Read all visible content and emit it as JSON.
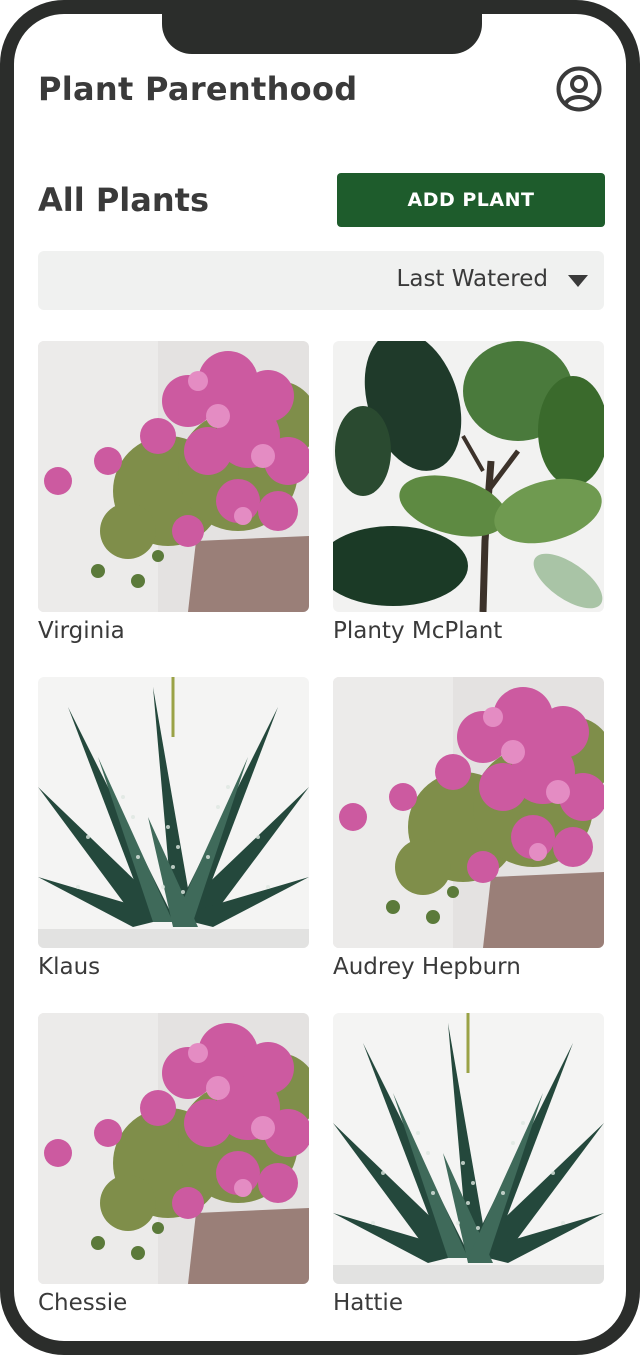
{
  "header": {
    "app_title": "Plant Parenthood",
    "profile_icon": "user-circle-icon"
  },
  "section": {
    "title": "All Plants",
    "add_button_label": "ADD PLANT"
  },
  "sort": {
    "selected": "Last Watered",
    "caret_icon": "caret-down-icon"
  },
  "colors": {
    "primary": "#1e5c2c",
    "text": "#3a3a3a",
    "frame": "#2b2d2b",
    "sort_bg": "#f0f1f0"
  },
  "plants": [
    {
      "name": "Virginia",
      "photo": "flowering-succulent"
    },
    {
      "name": "Planty McPlant",
      "photo": "fiddle-leaf-fig"
    },
    {
      "name": "Klaus",
      "photo": "zebra-haworthia"
    },
    {
      "name": "Audrey Hepburn",
      "photo": "flowering-succulent"
    },
    {
      "name": "Chessie",
      "photo": "flowering-succulent"
    },
    {
      "name": "Hattie",
      "photo": "zebra-haworthia"
    }
  ]
}
